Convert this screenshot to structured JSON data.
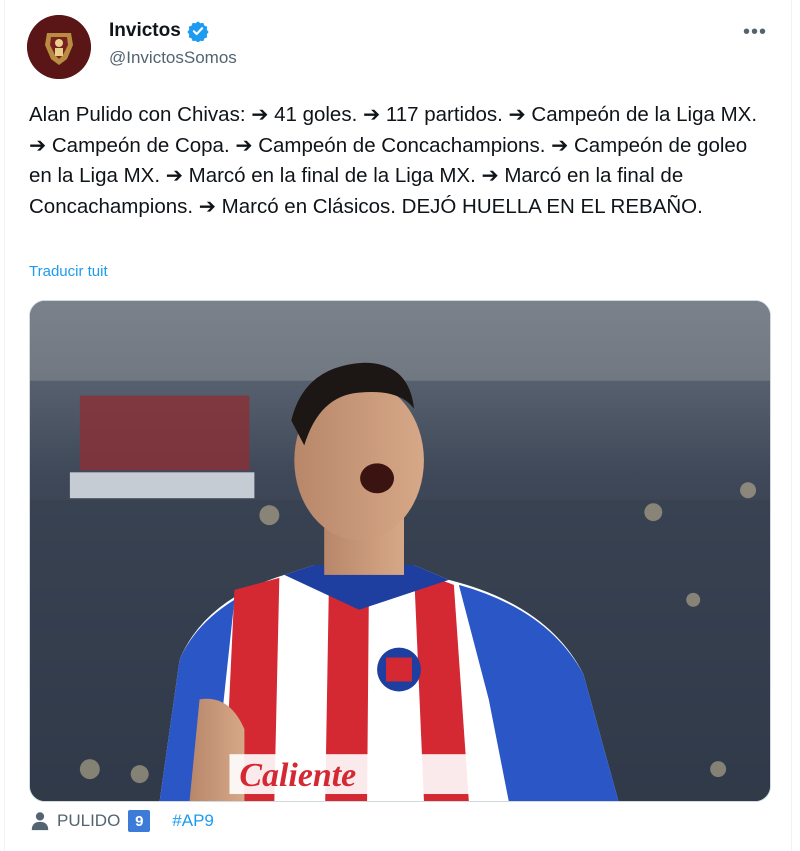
{
  "author": {
    "display_name": "Invictos",
    "handle": "@InvictosSomos",
    "verified": true
  },
  "tweet": {
    "text": "Alan Pulido con Chivas: ➔ 41 goles. ➔ 117 partidos. ➔ Campeón de la Liga MX. ➔ Campeón de Copa. ➔ Campeón de Concachampions. ➔ Campeón de goleo en la Liga MX. ➔ Marcó en la final de la Liga MX. ➔ Marcó en la final de Concachampions. ➔ Marcó en Clásicos. DEJÓ HUELLA EN EL REBAÑO.",
    "translate_label": "Traducir tuit",
    "image_text": {
      "jersey_sponsor": "Caliente"
    }
  },
  "tags": {
    "person_tag": "PULIDO",
    "number_badge": "9",
    "hashtag": "#AP9"
  },
  "icons": {
    "more": "more-options-icon",
    "verified": "verified-badge-icon",
    "person": "person-icon"
  },
  "colors": {
    "link": "#1d9bf0",
    "verified": "#1d9bf0",
    "secondary_text": "#536471",
    "avatar_bg": "#5a1616"
  }
}
